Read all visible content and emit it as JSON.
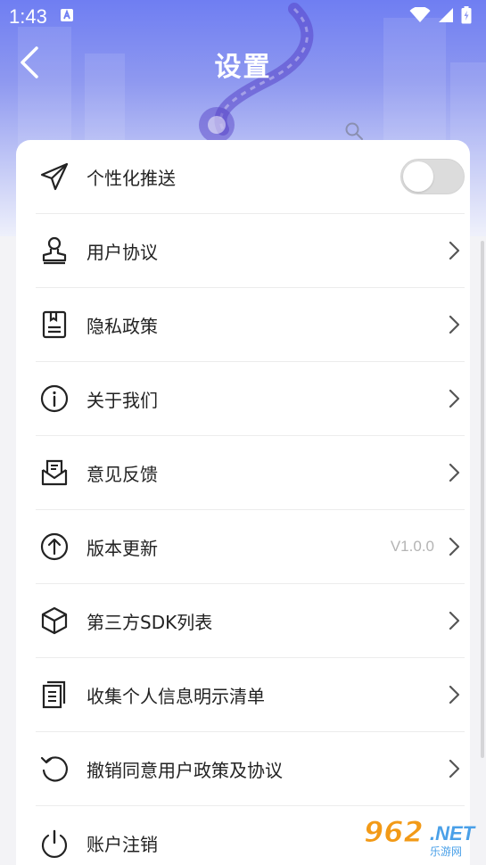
{
  "status_bar": {
    "time": "1:43",
    "notification_icon": "a-letter-icon",
    "icons": [
      "wifi-icon",
      "signal-icon",
      "battery-icon"
    ]
  },
  "header": {
    "title": "设置",
    "back_icon": "chevron-left-icon"
  },
  "settings": {
    "items": [
      {
        "label": "个性化推送",
        "icon": "paper-plane-icon",
        "control": "toggle",
        "toggle_on": false
      },
      {
        "label": "用户协议",
        "icon": "stamp-icon",
        "control": "chevron"
      },
      {
        "label": "隐私政策",
        "icon": "document-icon",
        "control": "chevron"
      },
      {
        "label": "关于我们",
        "icon": "info-icon",
        "control": "chevron"
      },
      {
        "label": "意见反馈",
        "icon": "mail-icon",
        "control": "chevron"
      },
      {
        "label": "版本更新",
        "icon": "arrow-up-circle-icon",
        "control": "chevron",
        "value": "V1.0.0"
      },
      {
        "label": "第三方SDK列表",
        "icon": "cube-icon",
        "control": "chevron"
      },
      {
        "label": "收集个人信息明示清单",
        "icon": "list-document-icon",
        "control": "chevron"
      },
      {
        "label": "撤销同意用户政策及协议",
        "icon": "undo-icon",
        "control": "chevron"
      },
      {
        "label": "账户注销",
        "icon": "power-icon",
        "control": "none"
      }
    ]
  },
  "watermark": {
    "number": "962",
    "domain": ".NET",
    "subtitle": "乐游网"
  },
  "colors": {
    "header_gradient_top": "#6f7ef2",
    "header_gradient_bottom": "#eef0fb",
    "toggle_off": "#dcdcdc",
    "label_text": "#222222",
    "value_text": "#b4b4b4"
  }
}
